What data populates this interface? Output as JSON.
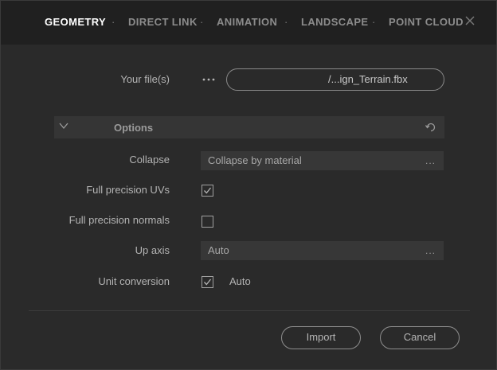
{
  "tabs": [
    {
      "label": "GEOMETRY",
      "active": true
    },
    {
      "label": "DIRECT LINK",
      "active": false
    },
    {
      "label": "ANIMATION",
      "active": false
    },
    {
      "label": "LANDSCAPE",
      "active": false
    },
    {
      "label": "POINT CLOUD",
      "active": false
    }
  ],
  "tab_separator": "·",
  "file": {
    "label": "Your file(s)",
    "browse_icon": "ellipsis-icon",
    "value": "/...ign_Terrain.fbx"
  },
  "options": {
    "title": "Options",
    "collapse": {
      "label": "Collapse",
      "value": "Collapse by material",
      "more": "..."
    },
    "full_precision_uvs": {
      "label": "Full precision UVs",
      "checked": true
    },
    "full_precision_normals": {
      "label": "Full precision normals",
      "checked": false
    },
    "up_axis": {
      "label": "Up axis",
      "value": "Auto",
      "more": "..."
    },
    "unit_conversion": {
      "label": "Unit conversion",
      "checked": true,
      "value": "Auto"
    }
  },
  "buttons": {
    "import": "Import",
    "cancel": "Cancel"
  },
  "colors": {
    "background": "#2a2a2a",
    "tabbar": "#202020",
    "active_tab": "#ffffff"
  }
}
